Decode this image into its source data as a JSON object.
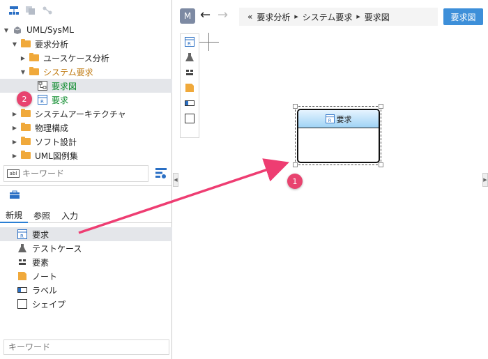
{
  "tree": {
    "root": "UML/SysML",
    "items": [
      {
        "label": "要求分析"
      },
      {
        "label": "ユースケース分析"
      },
      {
        "label": "システム要求"
      },
      {
        "label": "要求図"
      },
      {
        "label": "要求"
      },
      {
        "label": "システムアーキテクチャ"
      },
      {
        "label": "物理構成"
      },
      {
        "label": "ソフト設計"
      },
      {
        "label": "UML図例集"
      }
    ]
  },
  "search_top": {
    "placeholder": "キーワード"
  },
  "toolbox": {
    "tabs": [
      "新規",
      "参照",
      "入力"
    ],
    "items": [
      "要求",
      "テストケース",
      "要素",
      "ノート",
      "ラベル",
      "シェイプ"
    ]
  },
  "search_bottom": {
    "placeholder": "キーワード"
  },
  "main": {
    "m_label": "M",
    "breadcrumb": [
      "要求分析",
      "システム要求",
      "要求図"
    ],
    "crumb_prefix": "«",
    "diagram_button": "要求図",
    "block_title": "要求",
    "block_icon_letter": "R"
  },
  "badges": {
    "one": "1",
    "two": "2"
  },
  "colors": {
    "accent": "#3d8fd9",
    "badge": "#e8436f",
    "arrow": "#ee3d72",
    "folder": "#f0a93b"
  }
}
